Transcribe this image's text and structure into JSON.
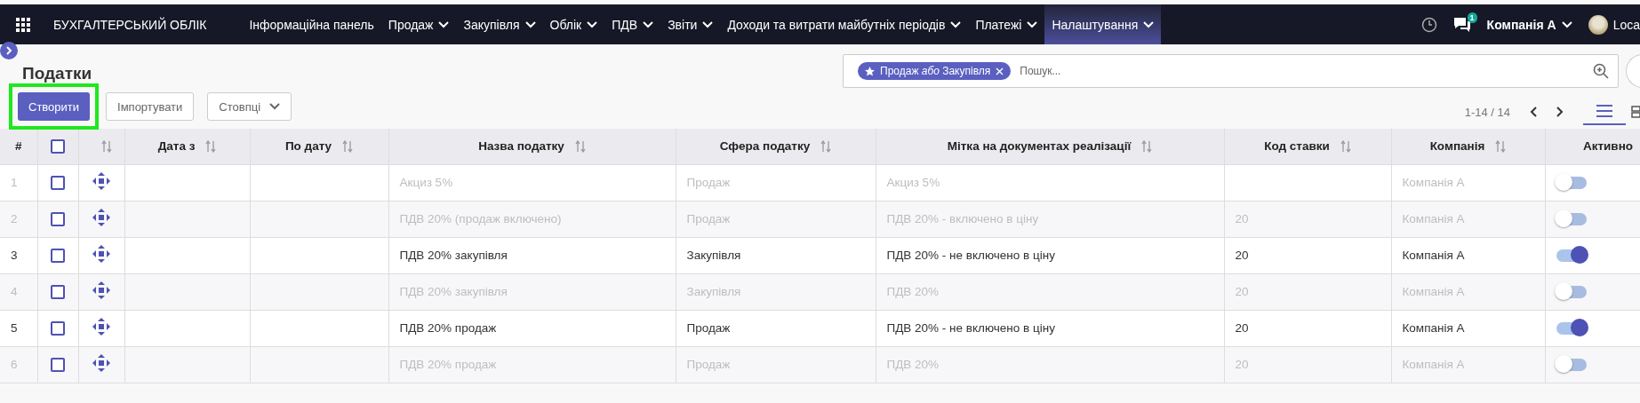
{
  "navbar": {
    "brand": "БУХГАЛТЕРСЬКИЙ ОБЛІК",
    "menu": [
      {
        "label": "Інформаційна панель",
        "dropdown": false,
        "selected": false
      },
      {
        "label": "Продаж",
        "dropdown": true,
        "selected": false
      },
      {
        "label": "Закупівля",
        "dropdown": true,
        "selected": false
      },
      {
        "label": "Облік",
        "dropdown": true,
        "selected": false
      },
      {
        "label": "ПДВ",
        "dropdown": true,
        "selected": false
      },
      {
        "label": "Звіти",
        "dropdown": true,
        "selected": false
      },
      {
        "label": "Доходи та витрати майбутніх періодів",
        "dropdown": true,
        "selected": false
      },
      {
        "label": "Платежі",
        "dropdown": true,
        "selected": false
      },
      {
        "label": "Налаштування",
        "dropdown": true,
        "selected": true
      }
    ],
    "messages_badge": "1",
    "company": "Компанія A",
    "user": "Loca"
  },
  "page": {
    "title": "Податки",
    "buttons": [
      {
        "kind": "primary",
        "label": "Створити",
        "highlighted": true
      },
      {
        "kind": "secondary",
        "label": "Імпортувати"
      },
      {
        "kind": "dropdown",
        "label": "Стовпці"
      }
    ]
  },
  "search": {
    "facet": "Продаж *або* Закупівля",
    "placeholder": "Пошук..."
  },
  "pager": "1-14 / 14",
  "table": {
    "columns": [
      {
        "label": "#",
        "sortable": false
      },
      {
        "kind": "checkbox",
        "checked": false,
        "sortable": false
      },
      {
        "kind": "handle",
        "sortable": true
      },
      {
        "label": "Дата з",
        "sortable": true
      },
      {
        "label": "По дату",
        "sortable": true
      },
      {
        "label": "Назва податку",
        "sortable": true
      },
      {
        "label": "Сфера податку",
        "sortable": true
      },
      {
        "label": "Мітка на документах реалізації",
        "sortable": true
      },
      {
        "label": "Код ставки",
        "sortable": true
      },
      {
        "label": "Компанія",
        "sortable": true
      },
      {
        "label": "Активно",
        "sortable": false
      }
    ],
    "rows": [
      {
        "number": "1",
        "checked": false,
        "name": "Акциз 5%",
        "scope": "Продаж",
        "invoice_label": "Акциз 5%",
        "code": "",
        "company": "Компанія A",
        "active": false
      },
      {
        "number": "2",
        "checked": false,
        "name": "ПДВ 20% (продаж включено)",
        "scope": "Продаж",
        "invoice_label": "ПДВ 20% - включено в ціну",
        "code": "20",
        "company": "Компанія A",
        "active": false
      },
      {
        "number": "3",
        "checked": false,
        "name": "ПДВ 20% закупівля",
        "scope": "Закупівля",
        "invoice_label": "ПДВ 20% - не включено в ціну",
        "code": "20",
        "company": "Компанія A",
        "active": true
      },
      {
        "number": "4",
        "checked": false,
        "name": "ПДВ 20% закупівля",
        "scope": "Закупівля",
        "invoice_label": "ПДВ 20%",
        "code": "20",
        "company": "Компанія A",
        "active": false
      },
      {
        "number": "5",
        "checked": false,
        "name": "ПДВ 20% продаж",
        "scope": "Продаж",
        "invoice_label": "ПДВ 20% - не включено в ціну",
        "code": "20",
        "company": "Компанія A",
        "active": true
      },
      {
        "number": "6",
        "checked": false,
        "name": "ПДВ 20% продаж",
        "scope": "Продаж",
        "invoice_label": "ПДВ 20%",
        "code": "20",
        "company": "Компанія A",
        "active": false
      }
    ]
  }
}
